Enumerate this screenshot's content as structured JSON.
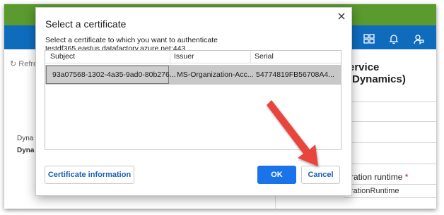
{
  "background": {
    "refresh_label": "Refres",
    "left_text_1": "Dyna",
    "left_text_2": "Dyna",
    "panel_title": "ervice (Dynamics)",
    "runtime_label": "ration runtime",
    "runtime_required": "*",
    "runtime_value": "rationRuntime",
    "colors": {
      "green_bar": "#5a9a2e",
      "blue_bar": "#0f6cbd"
    },
    "icons": [
      "settings-icon",
      "directory-icon",
      "notification-bell-icon",
      "feedback-icon"
    ]
  },
  "dialog": {
    "title": "Select a certificate",
    "subtitle": "Select a certificate to which you want to authenticate testdf365.eastus.datafactory.azure.net:443",
    "columns": [
      "Subject",
      "Issuer",
      "Serial"
    ],
    "rows": [
      {
        "subject": "93a07568-1302-4a35-9ad0-80b276...",
        "issuer": "MS-Organization-Acc...",
        "serial": "54774819FB56708A4..."
      }
    ],
    "buttons": {
      "info": "Certificate information",
      "ok": "OK",
      "cancel": "Cancel"
    },
    "colors": {
      "ok_button": "#1a73e8",
      "link_text": "#1a5fb4",
      "selected_row": "#c8c8c8"
    }
  },
  "annotation": {
    "arrow_color": "#e8453c"
  }
}
